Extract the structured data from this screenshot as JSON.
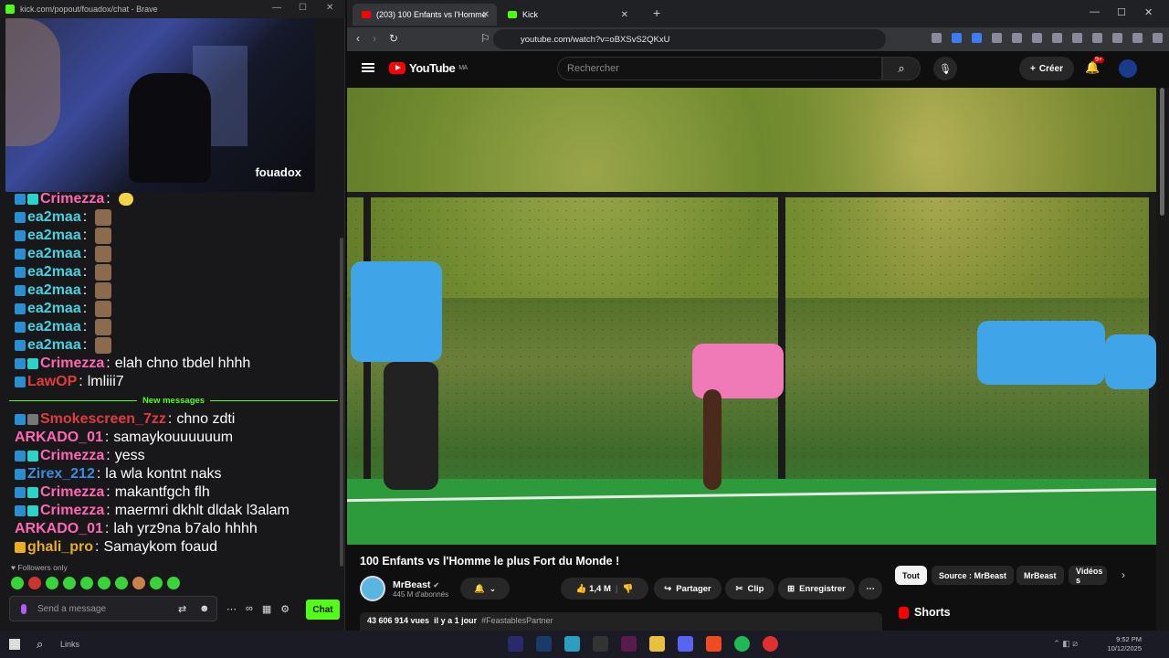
{
  "kick": {
    "window_title": "kick.com/popout/fouadox/chat - Brave",
    "streamer": "fouadox",
    "messages_old": [
      {
        "user": "Crimezza",
        "text": "",
        "color": "#ff66b3",
        "badges": [
          "bb",
          "bg"
        ],
        "emote": "yellow"
      },
      {
        "user": "ea2maa",
        "text": "",
        "color": "#48d1e0",
        "badges": [
          "bb"
        ],
        "emote": "cat"
      },
      {
        "user": "ea2maa",
        "text": "",
        "color": "#48d1e0",
        "badges": [
          "bb"
        ],
        "emote": "cat"
      },
      {
        "user": "ea2maa",
        "text": "",
        "color": "#48d1e0",
        "badges": [
          "bb"
        ],
        "emote": "cat"
      },
      {
        "user": "ea2maa",
        "text": "",
        "color": "#48d1e0",
        "badges": [
          "bb"
        ],
        "emote": "cat"
      },
      {
        "user": "ea2maa",
        "text": "",
        "color": "#48d1e0",
        "badges": [
          "bb"
        ],
        "emote": "cat"
      },
      {
        "user": "ea2maa",
        "text": "",
        "color": "#48d1e0",
        "badges": [
          "bb"
        ],
        "emote": "cat"
      },
      {
        "user": "ea2maa",
        "text": "",
        "color": "#48d1e0",
        "badges": [
          "bb"
        ],
        "emote": "cat"
      },
      {
        "user": "ea2maa",
        "text": "",
        "color": "#48d1e0",
        "badges": [
          "bb"
        ],
        "emote": "cat"
      },
      {
        "user": "Crimezza",
        "text": "elah chno tbdel hhhh",
        "color": "#ff66b3",
        "badges": [
          "bb",
          "bg"
        ],
        "emote": ""
      },
      {
        "user": "LawOP",
        "text": "lmliii7",
        "color": "#e03c3c",
        "badges": [
          "bb"
        ],
        "emote": ""
      }
    ],
    "new_messages_label": "New messages",
    "messages_new": [
      {
        "user": "Smokescreen_7zz",
        "text": "chno zdti",
        "color": "#e03c3c",
        "badges": [
          "bb",
          "bgr"
        ],
        "emote": ""
      },
      {
        "user": "ARKADO_01",
        "text": "samaykouuuuuum",
        "color": "#ff66b3",
        "badges": [],
        "emote": ""
      },
      {
        "user": "Crimezza",
        "text": "yess",
        "color": "#ff66b3",
        "badges": [
          "bb",
          "bg"
        ],
        "emote": ""
      },
      {
        "user": "Zirex_212",
        "text": "la wla kontnt naks",
        "color": "#3c8ce0",
        "badges": [
          "bb"
        ],
        "emote": ""
      },
      {
        "user": "Crimezza",
        "text": "makantfgch flh",
        "color": "#ff66b3",
        "badges": [
          "bb",
          "bg"
        ],
        "emote": ""
      },
      {
        "user": "Crimezza",
        "text": "maermri dkhlt dldak l3alam",
        "color": "#ff66b3",
        "badges": [
          "bb",
          "bg"
        ],
        "emote": ""
      },
      {
        "user": "ARKADO_01",
        "text": "lah yrz9na b7alo hhhh",
        "color": "#ff66b3",
        "badges": [],
        "emote": ""
      },
      {
        "user": "ghali_pro",
        "text": "Samaykom foaud",
        "color": "#e8b020",
        "badges": [
          "bc"
        ],
        "emote": ""
      }
    ],
    "followers_only": "Followers only",
    "input_placeholder": "Send a message",
    "chat_button": "Chat"
  },
  "browser": {
    "tabs": [
      {
        "label": "(203) 100 Enfants vs l'Homme",
        "active": true
      },
      {
        "label": "Kick",
        "active": false
      }
    ],
    "url": "youtube.com/watch?v=oBXSvS2QKxU"
  },
  "youtube": {
    "logo_text": "YouTube",
    "region": "MA",
    "search_placeholder": "Rechercher",
    "create_label": "Créer",
    "notif_count": "9+",
    "video_title": "100 Enfants vs l'Homme le plus Fort du Monde !",
    "channel_name": "MrBeast",
    "subscribers": "445 M d'abonnés",
    "likes": "1,4 M",
    "share_label": "Partager",
    "clip_label": "Clip",
    "save_label": "Enregistrer",
    "views": "43 606 914 vues",
    "posted": "il y a 1 jour",
    "hashtag": "#FeastablesPartner",
    "chips": [
      "Tout",
      "Source : MrBeast",
      "MrBeast",
      "Vidéos s"
    ],
    "shorts_label": "Shorts"
  },
  "taskbar": {
    "links_label": "Links",
    "time": "9:52 PM",
    "date": "10/12/2025"
  }
}
